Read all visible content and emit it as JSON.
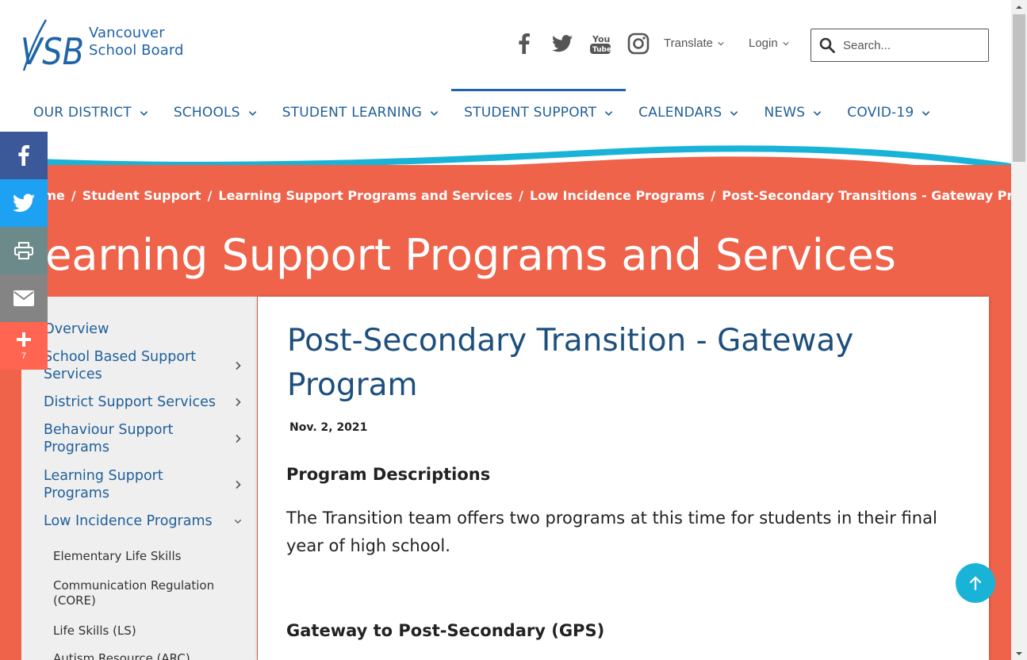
{
  "logo": {
    "line1": "Vancouver",
    "line2": "School Board"
  },
  "social_icons": [
    "facebook-icon",
    "twitter-icon",
    "youtube-icon",
    "instagram-icon"
  ],
  "utility": {
    "translate": "Translate",
    "login": "Login"
  },
  "search": {
    "placeholder": "Search..."
  },
  "nav": [
    {
      "label": "OUR DISTRICT"
    },
    {
      "label": "SCHOOLS"
    },
    {
      "label": "STUDENT LEARNING"
    },
    {
      "label": "STUDENT SUPPORT",
      "active": true
    },
    {
      "label": "CALENDARS"
    },
    {
      "label": "NEWS"
    },
    {
      "label": "COVID-19"
    }
  ],
  "breadcrumb": [
    "Home",
    "Student Support",
    "Learning Support Programs and Services",
    "Low Incidence Programs",
    "Post-Secondary Transitions - Gateway Programs"
  ],
  "section_title": "Learning Support Programs and Services",
  "sidebar": {
    "items": [
      {
        "label": "Overview"
      },
      {
        "label": "School Based Support Services"
      },
      {
        "label": "District Support Services"
      },
      {
        "label": "Behaviour Support Programs"
      },
      {
        "label": "Learning Support Programs"
      },
      {
        "label": "Low Incidence Programs"
      }
    ],
    "subitems": [
      {
        "label": "Elementary Life Skills"
      },
      {
        "label": "Communication Regulation (CORE)"
      },
      {
        "label": "Life Skills (LS)"
      },
      {
        "label": "Autism Resource (ARC)"
      }
    ]
  },
  "content": {
    "title": "Post-Secondary Transition - Gateway Program",
    "date": "Nov. 2, 2021",
    "heading1": "Program Descriptions",
    "paragraph": "The Transition team offers two programs at this time for students in their final year of high school.",
    "heading2": "Gateway to Post-Secondary (GPS)"
  },
  "share": {
    "count": "7"
  },
  "colors": {
    "brand_blue": "#1f64a8",
    "banner_orange": "#ee634a",
    "wave_cyan": "#1ab3d8",
    "facebook": "#3b5998",
    "twitter": "#1da1f2",
    "print": "#6d8a8a",
    "email": "#848484",
    "more": "#ff6550"
  }
}
